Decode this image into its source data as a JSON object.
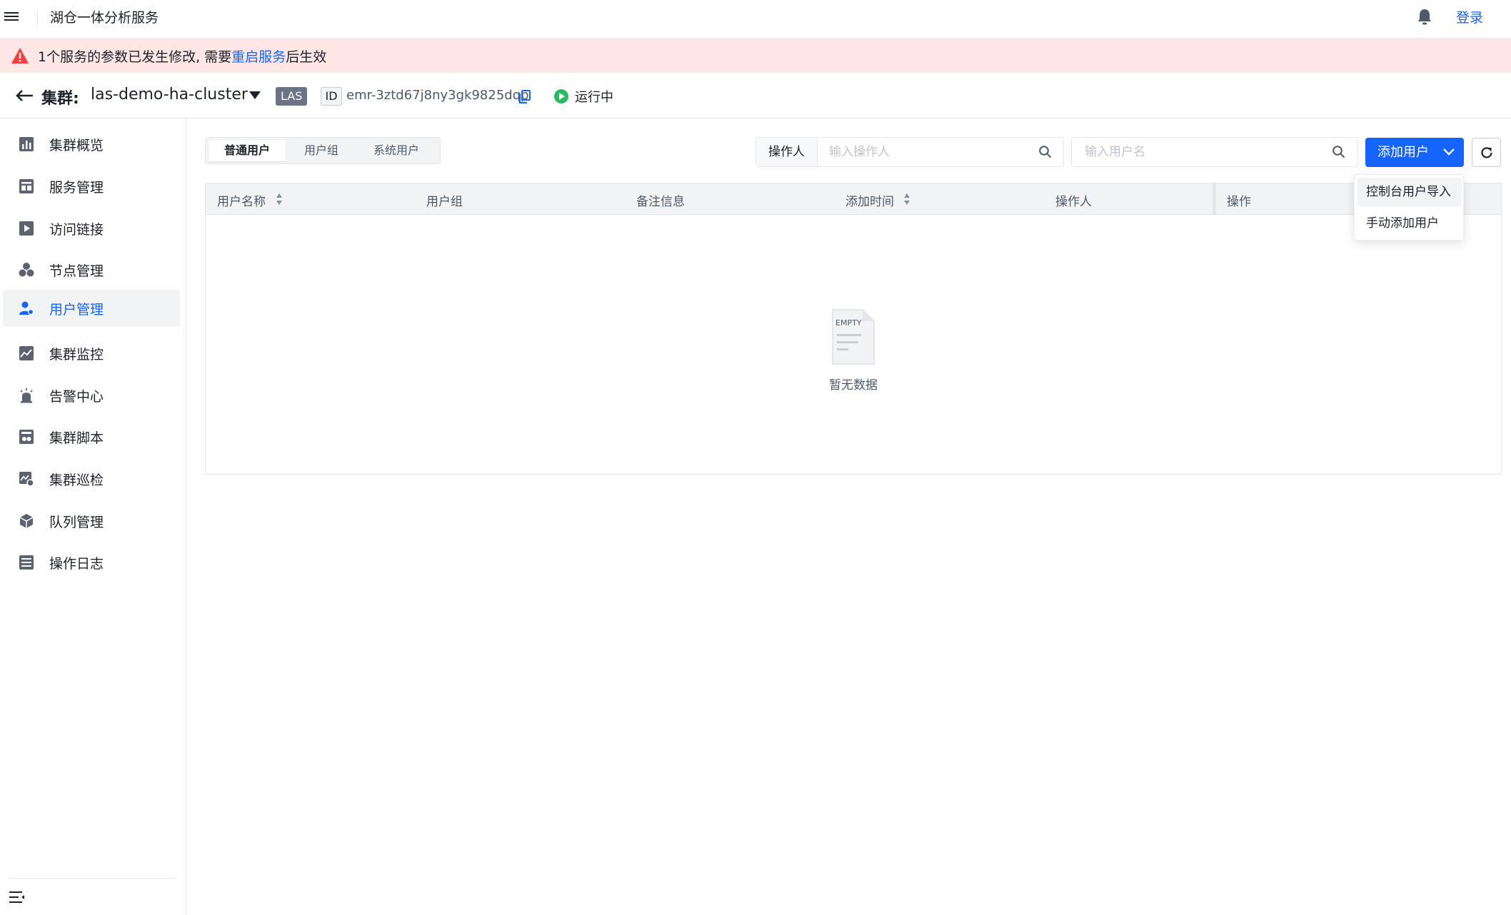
{
  "topbar": {
    "app_title": "湖仓一体分析服务",
    "login_label": "登录"
  },
  "alert": {
    "prefix": "1个服务的参数已发生修改, 需要",
    "link": "重启服务",
    "suffix": "后生效"
  },
  "cluster": {
    "label": "集群:",
    "name": "las-demo-ha-cluster",
    "type_tag": "LAS",
    "id_label": "ID",
    "id_value": "emr-3ztd67j8ny3gk9825dqp",
    "status": "运行中"
  },
  "sidebar": {
    "items": [
      {
        "label": "集群概览",
        "icon": "bar-chart-icon"
      },
      {
        "label": "服务管理",
        "icon": "service-icon"
      },
      {
        "label": "访问链接",
        "icon": "play-link-icon"
      },
      {
        "label": "节点管理",
        "icon": "nodes-icon"
      },
      {
        "label": "用户管理",
        "icon": "user-settings-icon",
        "active": true
      },
      {
        "label": "集群监控",
        "icon": "monitor-icon"
      },
      {
        "label": "告警中心",
        "icon": "alarm-icon"
      },
      {
        "label": "集群脚本",
        "icon": "script-icon"
      },
      {
        "label": "集群巡检",
        "icon": "inspection-icon"
      },
      {
        "label": "队列管理",
        "icon": "queue-icon"
      },
      {
        "label": "操作日志",
        "icon": "log-icon"
      }
    ]
  },
  "tabs": [
    {
      "label": "普通用户",
      "active": true
    },
    {
      "label": "用户组",
      "active": false
    },
    {
      "label": "系统用户",
      "active": false
    }
  ],
  "filters": {
    "operator_prefix": "操作人",
    "operator_placeholder": "输入操作人",
    "username_placeholder": "输入用户名"
  },
  "toolbar": {
    "add_user_label": "添加用户"
  },
  "dropdown": {
    "items": [
      "控制台用户导入",
      "手动添加用户"
    ]
  },
  "table": {
    "columns": [
      "用户名称",
      "用户组",
      "备注信息",
      "添加时间",
      "操作人",
      "操作"
    ],
    "empty_image_text": "EMPTY",
    "empty_text": "暂无数据"
  },
  "colors": {
    "primary": "#1664ff",
    "alert_bg": "#fde6e4",
    "status_running": "#2db964"
  }
}
